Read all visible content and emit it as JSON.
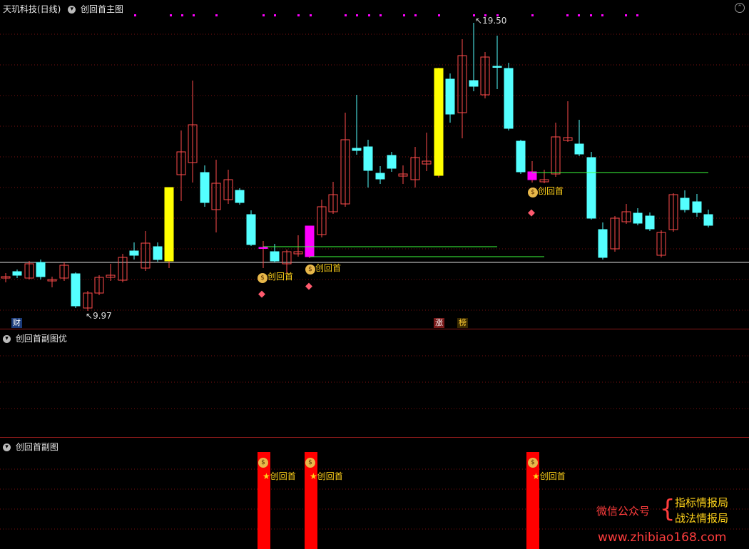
{
  "main": {
    "title": "天玑科技(日线)",
    "indicator": "创回首主图",
    "high_label": "19.50",
    "low_label": "9.97",
    "signal_label": "创回首",
    "tag_cai": "财",
    "tag_zhang": "涨",
    "tag_bang": "榜"
  },
  "sub1": {
    "title": "创回首副图优"
  },
  "sub2": {
    "title": "创回首副图",
    "signal_label": "创回首"
  },
  "watermark": {
    "line1": "微信公众号",
    "line2": "指标情报局",
    "line3": "战法情报局",
    "url": "www.zhibiao168.com"
  },
  "colors": {
    "up": "#ff4b4b",
    "down": "#54ffff",
    "highlight_yellow": "#ffff00",
    "highlight_magenta": "#ff00ff",
    "signal_bar": "#ff0000",
    "support_line": "#3cff3c",
    "grid": "#7a1010"
  },
  "icons": [
    "money-bag-icon",
    "diamond-icon",
    "star-icon",
    "chevron-down-icon"
  ]
}
